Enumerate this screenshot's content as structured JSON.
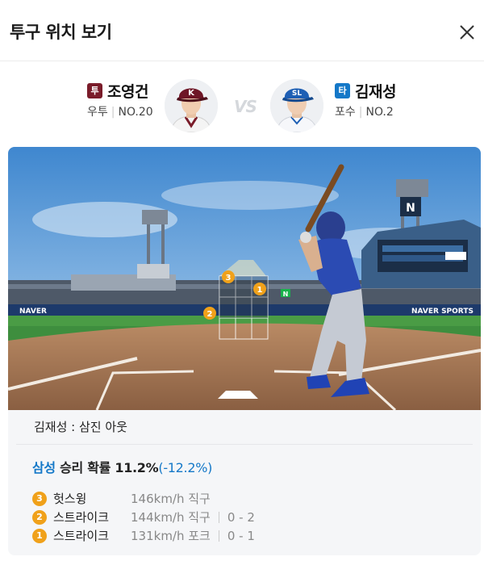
{
  "header": {
    "title": "투구 위치 보기"
  },
  "matchup": {
    "pitcher": {
      "role_badge": "투",
      "name": "조영건",
      "hand": "우투",
      "number": "NO.20"
    },
    "vs_label": "VS",
    "batter": {
      "role_badge": "타",
      "name": "김재성",
      "position": "포수",
      "number": "NO.2"
    }
  },
  "scene": {
    "pitch_markers": [
      "3",
      "1",
      "2"
    ],
    "ad_text": "NAVER",
    "ad_text_2": "NAVER SPORTS",
    "scoreboard_letter": "N",
    "sign_letter": "N"
  },
  "result": {
    "text": "김재성 : 삼진 아웃"
  },
  "win_probability": {
    "team": "삼성",
    "label": "승리 확률",
    "value": "11.2%",
    "delta": "(-12.2%)"
  },
  "pitches": [
    {
      "num": "3",
      "type": "헛스윙",
      "info": "146km/h 직구",
      "count": ""
    },
    {
      "num": "2",
      "type": "스트라이크",
      "info": "144km/h 직구",
      "count": "0 - 2"
    },
    {
      "num": "1",
      "type": "스트라이크",
      "info": "131km/h 포크",
      "count": "0 - 1"
    }
  ],
  "colors": {
    "accent": "#1478c8",
    "pitcher_badge": "#7a1c2a",
    "pitch_marker": "#f0a11a"
  }
}
